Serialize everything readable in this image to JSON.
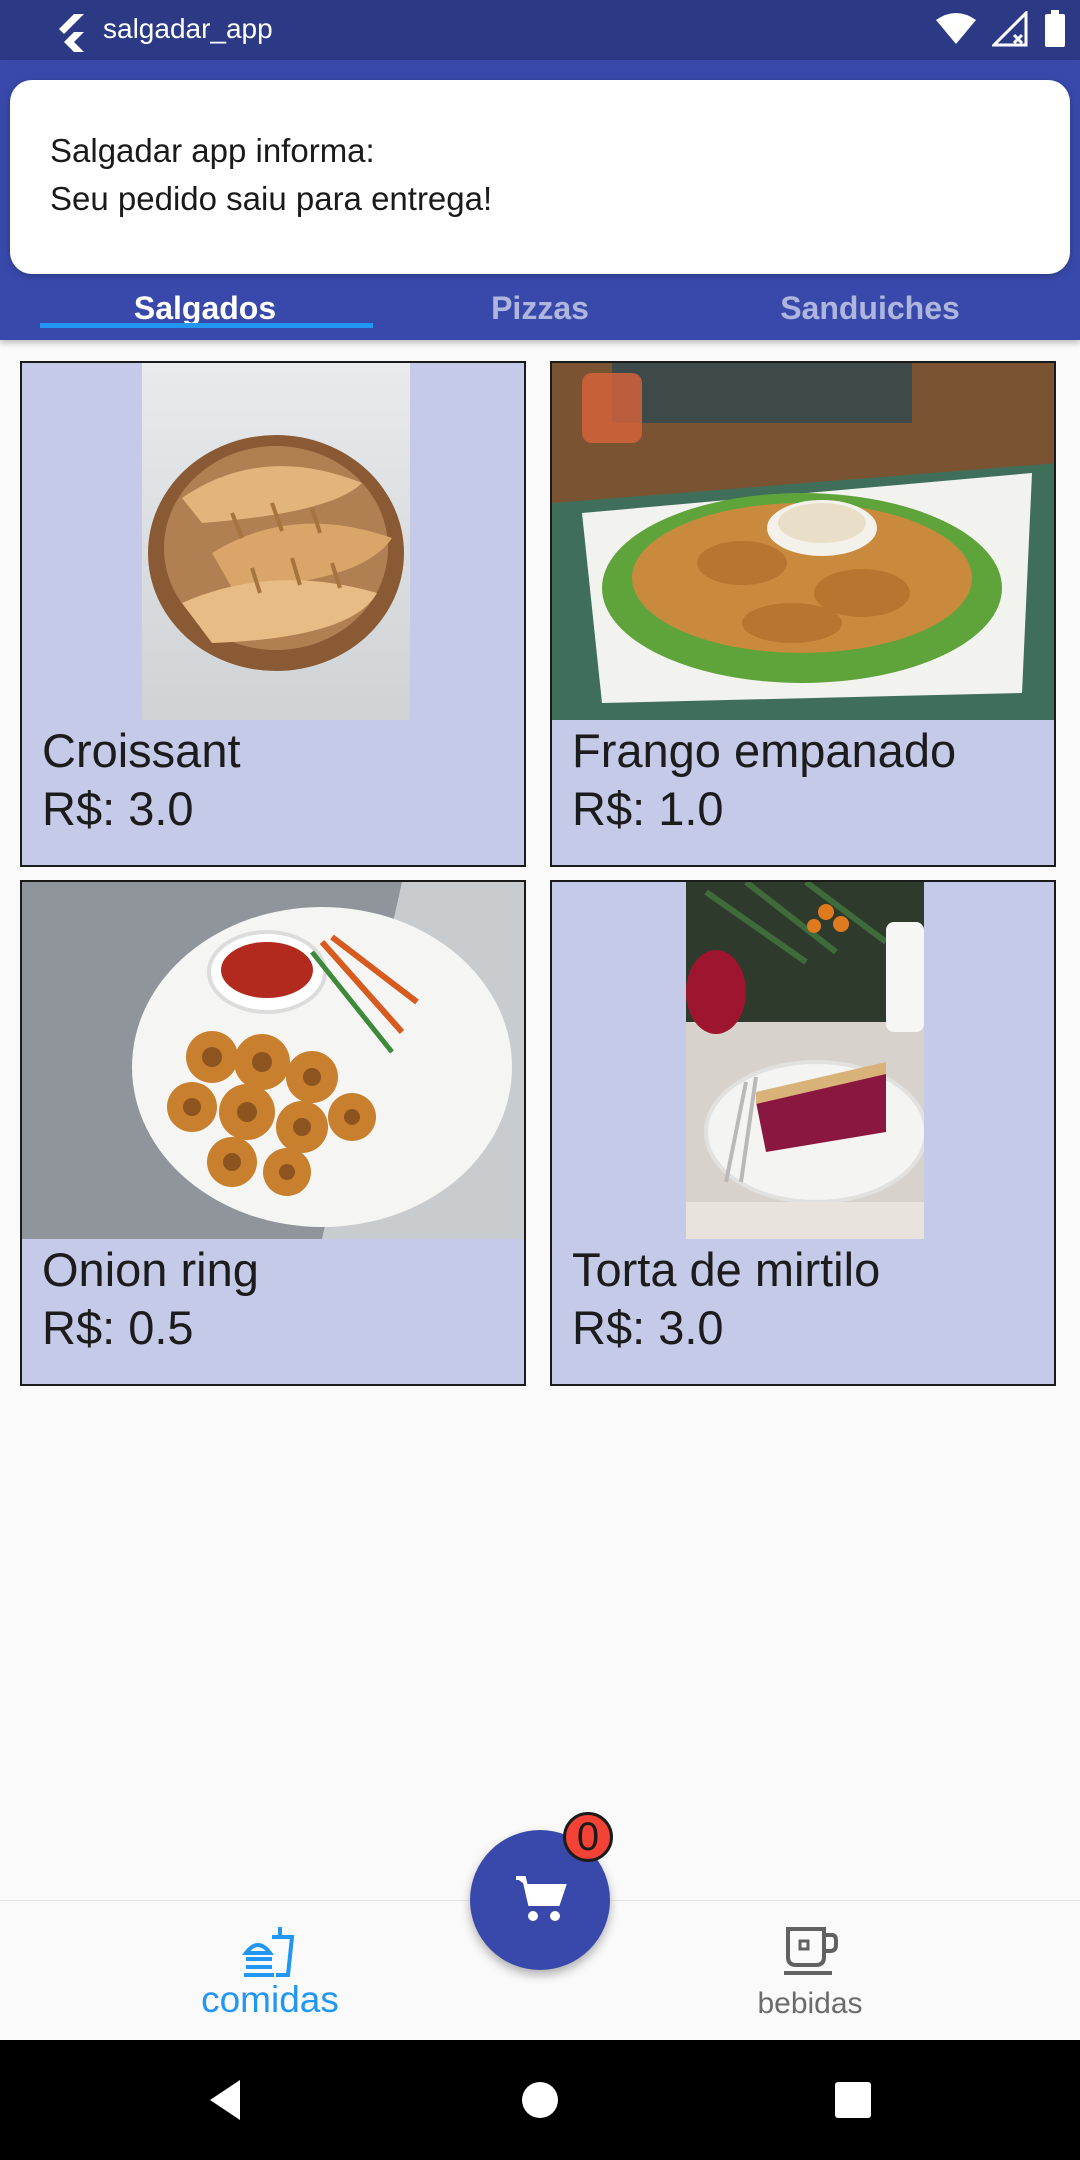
{
  "status_bar": {
    "app_name": "salgadar_app",
    "icons": [
      "flutter-logo-icon",
      "wifi-icon",
      "signal-icon",
      "battery-icon"
    ]
  },
  "tabs": [
    {
      "label": "Salgados",
      "active": true
    },
    {
      "label": "Pizzas",
      "active": false
    },
    {
      "label": "Sanduiches",
      "active": false
    }
  ],
  "notification": {
    "line1": "Salgadar app informa:",
    "line2": "Seu pedido saiu para entrega!"
  },
  "products": [
    {
      "name": "Croissant",
      "price": "R$: 3.0"
    },
    {
      "name": "Frango empanado",
      "price": "R$: 1.0"
    },
    {
      "name": "Onion ring",
      "price": "R$: 0.5"
    },
    {
      "name": "Torta de mirtilo",
      "price": "R$: 3.0"
    }
  ],
  "cart": {
    "badge_count": "0"
  },
  "bottom_nav": [
    {
      "label": "comidas",
      "active": true,
      "icon": "fastfood-icon"
    },
    {
      "label": "bebidas",
      "active": false,
      "icon": "coffee-cup-icon"
    }
  ],
  "colors": {
    "primary": "#3949ab",
    "card_bg": "#c5cae9",
    "accent": "#2196f3",
    "badge": "#f44336"
  }
}
